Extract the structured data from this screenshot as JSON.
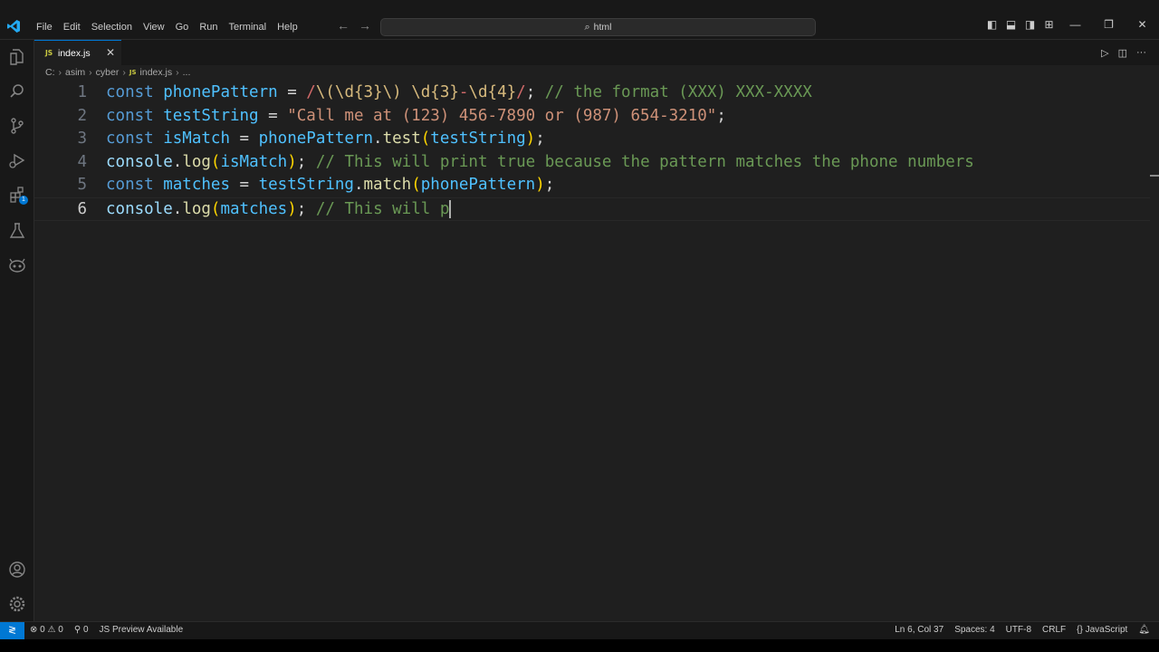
{
  "titlebar": {
    "menu": [
      "File",
      "Edit",
      "Selection",
      "View",
      "Go",
      "Run",
      "Terminal",
      "Help"
    ],
    "search_text": "html",
    "colors": {
      "accent": "#0078d4",
      "background": "#1f1f1f"
    }
  },
  "activity_bar": {
    "items": [
      "explorer-icon",
      "search-icon",
      "source-control-icon",
      "run-debug-icon",
      "extensions-icon",
      "testing-icon",
      "copilot-icon"
    ],
    "extensions_badge": "1",
    "bottom_items": [
      "account-icon",
      "settings-gear-icon"
    ]
  },
  "tab": {
    "name": "index.js",
    "icon_text": "JS"
  },
  "breadcrumb": {
    "parts": [
      "C:",
      "asim",
      "cyber"
    ],
    "file": "index.js",
    "tail": "..."
  },
  "editor": {
    "line_numbers": [
      "1",
      "2",
      "3",
      "4",
      "5",
      "6"
    ],
    "lines": [
      "const phonePattern = /\\(\\d{3}\\) \\d{3}-\\d{4}/; // the format (XXX) XXX-XXXX",
      "const testString = \"Call me at (123) 456-7890 or (987) 654-3210\";",
      "const isMatch = phonePattern.test(testString);",
      "console.log(isMatch); // This will print true because the pattern matches the phone numbers",
      "const matches = testString.match(phonePattern);",
      "console.log(matches); // This will p"
    ],
    "tokens": [
      [
        [
          "kw",
          "const"
        ],
        [
          "op",
          " "
        ],
        [
          "cst",
          "phonePattern"
        ],
        [
          "op",
          " = "
        ],
        [
          "rx",
          "/"
        ],
        [
          "esc",
          "\\("
        ],
        [
          "esc",
          "\\d"
        ],
        [
          "esc",
          "{3}"
        ],
        [
          "esc",
          "\\)"
        ],
        [
          "rx",
          " "
        ],
        [
          "esc",
          "\\d"
        ],
        [
          "esc",
          "{3}"
        ],
        [
          "rx",
          "-"
        ],
        [
          "esc",
          "\\d"
        ],
        [
          "esc",
          "{4}"
        ],
        [
          "rx",
          "/"
        ],
        [
          "op",
          "; "
        ],
        [
          "cm",
          "// the format (XXX) XXX-XXXX"
        ]
      ],
      [
        [
          "kw",
          "const"
        ],
        [
          "op",
          " "
        ],
        [
          "cst",
          "testString"
        ],
        [
          "op",
          " = "
        ],
        [
          "str",
          "\"Call me at (123) 456-7890 or (987) 654-3210\""
        ],
        [
          "op",
          ";"
        ]
      ],
      [
        [
          "kw",
          "const"
        ],
        [
          "op",
          " "
        ],
        [
          "cst",
          "isMatch"
        ],
        [
          "op",
          " = "
        ],
        [
          "cst",
          "phonePattern"
        ],
        [
          "op",
          "."
        ],
        [
          "fn",
          "test"
        ],
        [
          "br1",
          "("
        ],
        [
          "cst",
          "testString"
        ],
        [
          "br1",
          ")"
        ],
        [
          "op",
          ";"
        ]
      ],
      [
        [
          "var",
          "console"
        ],
        [
          "op",
          "."
        ],
        [
          "fn",
          "log"
        ],
        [
          "br1",
          "("
        ],
        [
          "cst",
          "isMatch"
        ],
        [
          "br1",
          ")"
        ],
        [
          "op",
          "; "
        ],
        [
          "cm",
          "// This will print true because the pattern matches the phone numbers"
        ]
      ],
      [
        [
          "kw",
          "const"
        ],
        [
          "op",
          " "
        ],
        [
          "cst",
          "matches"
        ],
        [
          "op",
          " = "
        ],
        [
          "cst",
          "testString"
        ],
        [
          "op",
          "."
        ],
        [
          "fn",
          "match"
        ],
        [
          "br1",
          "("
        ],
        [
          "cst",
          "phonePattern"
        ],
        [
          "br1",
          ")"
        ],
        [
          "op",
          ";"
        ]
      ],
      [
        [
          "var",
          "console"
        ],
        [
          "op",
          "."
        ],
        [
          "fn",
          "log"
        ],
        [
          "br1",
          "("
        ],
        [
          "cst",
          "matches"
        ],
        [
          "br1",
          ")"
        ],
        [
          "op",
          "; "
        ],
        [
          "cm",
          "// This will p"
        ]
      ]
    ],
    "active_line": 6
  },
  "statusbar": {
    "errors": "0",
    "warnings": "0",
    "ports": "0",
    "preview": "JS Preview Available",
    "position": "Ln 6, Col 37",
    "spaces": "Spaces: 4",
    "encoding": "UTF-8",
    "eol": "CRLF",
    "language": "JavaScript"
  }
}
